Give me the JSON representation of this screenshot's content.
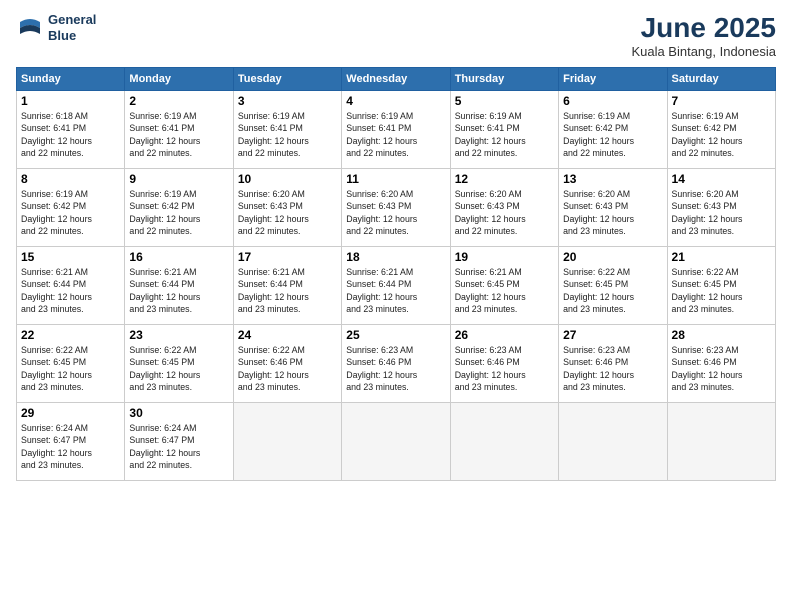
{
  "logo": {
    "line1": "General",
    "line2": "Blue"
  },
  "title": "June 2025",
  "subtitle": "Kuala Bintang, Indonesia",
  "days_of_week": [
    "Sunday",
    "Monday",
    "Tuesday",
    "Wednesday",
    "Thursday",
    "Friday",
    "Saturday"
  ],
  "weeks": [
    [
      {
        "day": 1,
        "info": "Sunrise: 6:18 AM\nSunset: 6:41 PM\nDaylight: 12 hours\nand 22 minutes."
      },
      {
        "day": 2,
        "info": "Sunrise: 6:19 AM\nSunset: 6:41 PM\nDaylight: 12 hours\nand 22 minutes."
      },
      {
        "day": 3,
        "info": "Sunrise: 6:19 AM\nSunset: 6:41 PM\nDaylight: 12 hours\nand 22 minutes."
      },
      {
        "day": 4,
        "info": "Sunrise: 6:19 AM\nSunset: 6:41 PM\nDaylight: 12 hours\nand 22 minutes."
      },
      {
        "day": 5,
        "info": "Sunrise: 6:19 AM\nSunset: 6:41 PM\nDaylight: 12 hours\nand 22 minutes."
      },
      {
        "day": 6,
        "info": "Sunrise: 6:19 AM\nSunset: 6:42 PM\nDaylight: 12 hours\nand 22 minutes."
      },
      {
        "day": 7,
        "info": "Sunrise: 6:19 AM\nSunset: 6:42 PM\nDaylight: 12 hours\nand 22 minutes."
      }
    ],
    [
      {
        "day": 8,
        "info": "Sunrise: 6:19 AM\nSunset: 6:42 PM\nDaylight: 12 hours\nand 22 minutes."
      },
      {
        "day": 9,
        "info": "Sunrise: 6:19 AM\nSunset: 6:42 PM\nDaylight: 12 hours\nand 22 minutes."
      },
      {
        "day": 10,
        "info": "Sunrise: 6:20 AM\nSunset: 6:43 PM\nDaylight: 12 hours\nand 22 minutes."
      },
      {
        "day": 11,
        "info": "Sunrise: 6:20 AM\nSunset: 6:43 PM\nDaylight: 12 hours\nand 22 minutes."
      },
      {
        "day": 12,
        "info": "Sunrise: 6:20 AM\nSunset: 6:43 PM\nDaylight: 12 hours\nand 22 minutes."
      },
      {
        "day": 13,
        "info": "Sunrise: 6:20 AM\nSunset: 6:43 PM\nDaylight: 12 hours\nand 23 minutes."
      },
      {
        "day": 14,
        "info": "Sunrise: 6:20 AM\nSunset: 6:43 PM\nDaylight: 12 hours\nand 23 minutes."
      }
    ],
    [
      {
        "day": 15,
        "info": "Sunrise: 6:21 AM\nSunset: 6:44 PM\nDaylight: 12 hours\nand 23 minutes."
      },
      {
        "day": 16,
        "info": "Sunrise: 6:21 AM\nSunset: 6:44 PM\nDaylight: 12 hours\nand 23 minutes."
      },
      {
        "day": 17,
        "info": "Sunrise: 6:21 AM\nSunset: 6:44 PM\nDaylight: 12 hours\nand 23 minutes."
      },
      {
        "day": 18,
        "info": "Sunrise: 6:21 AM\nSunset: 6:44 PM\nDaylight: 12 hours\nand 23 minutes."
      },
      {
        "day": 19,
        "info": "Sunrise: 6:21 AM\nSunset: 6:45 PM\nDaylight: 12 hours\nand 23 minutes."
      },
      {
        "day": 20,
        "info": "Sunrise: 6:22 AM\nSunset: 6:45 PM\nDaylight: 12 hours\nand 23 minutes."
      },
      {
        "day": 21,
        "info": "Sunrise: 6:22 AM\nSunset: 6:45 PM\nDaylight: 12 hours\nand 23 minutes."
      }
    ],
    [
      {
        "day": 22,
        "info": "Sunrise: 6:22 AM\nSunset: 6:45 PM\nDaylight: 12 hours\nand 23 minutes."
      },
      {
        "day": 23,
        "info": "Sunrise: 6:22 AM\nSunset: 6:45 PM\nDaylight: 12 hours\nand 23 minutes."
      },
      {
        "day": 24,
        "info": "Sunrise: 6:22 AM\nSunset: 6:46 PM\nDaylight: 12 hours\nand 23 minutes."
      },
      {
        "day": 25,
        "info": "Sunrise: 6:23 AM\nSunset: 6:46 PM\nDaylight: 12 hours\nand 23 minutes."
      },
      {
        "day": 26,
        "info": "Sunrise: 6:23 AM\nSunset: 6:46 PM\nDaylight: 12 hours\nand 23 minutes."
      },
      {
        "day": 27,
        "info": "Sunrise: 6:23 AM\nSunset: 6:46 PM\nDaylight: 12 hours\nand 23 minutes."
      },
      {
        "day": 28,
        "info": "Sunrise: 6:23 AM\nSunset: 6:46 PM\nDaylight: 12 hours\nand 23 minutes."
      }
    ],
    [
      {
        "day": 29,
        "info": "Sunrise: 6:24 AM\nSunset: 6:47 PM\nDaylight: 12 hours\nand 23 minutes."
      },
      {
        "day": 30,
        "info": "Sunrise: 6:24 AM\nSunset: 6:47 PM\nDaylight: 12 hours\nand 22 minutes."
      },
      {
        "day": null
      },
      {
        "day": null
      },
      {
        "day": null
      },
      {
        "day": null
      },
      {
        "day": null
      }
    ]
  ]
}
